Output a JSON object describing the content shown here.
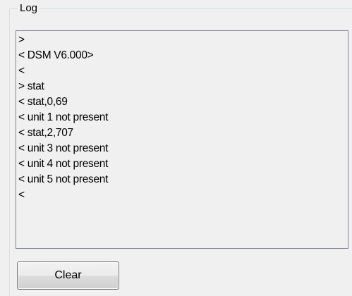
{
  "group": {
    "title": "Log"
  },
  "log": {
    "lines": [
      ">",
      "< DSM V6.000>",
      "<",
      "> stat",
      "< stat,0,69",
      "< unit 1 not present",
      "< stat,2,707",
      "< unit 3 not present",
      "< unit 4 not present",
      "< unit 5 not present",
      "<"
    ]
  },
  "buttons": {
    "clear_label": "Clear"
  }
}
